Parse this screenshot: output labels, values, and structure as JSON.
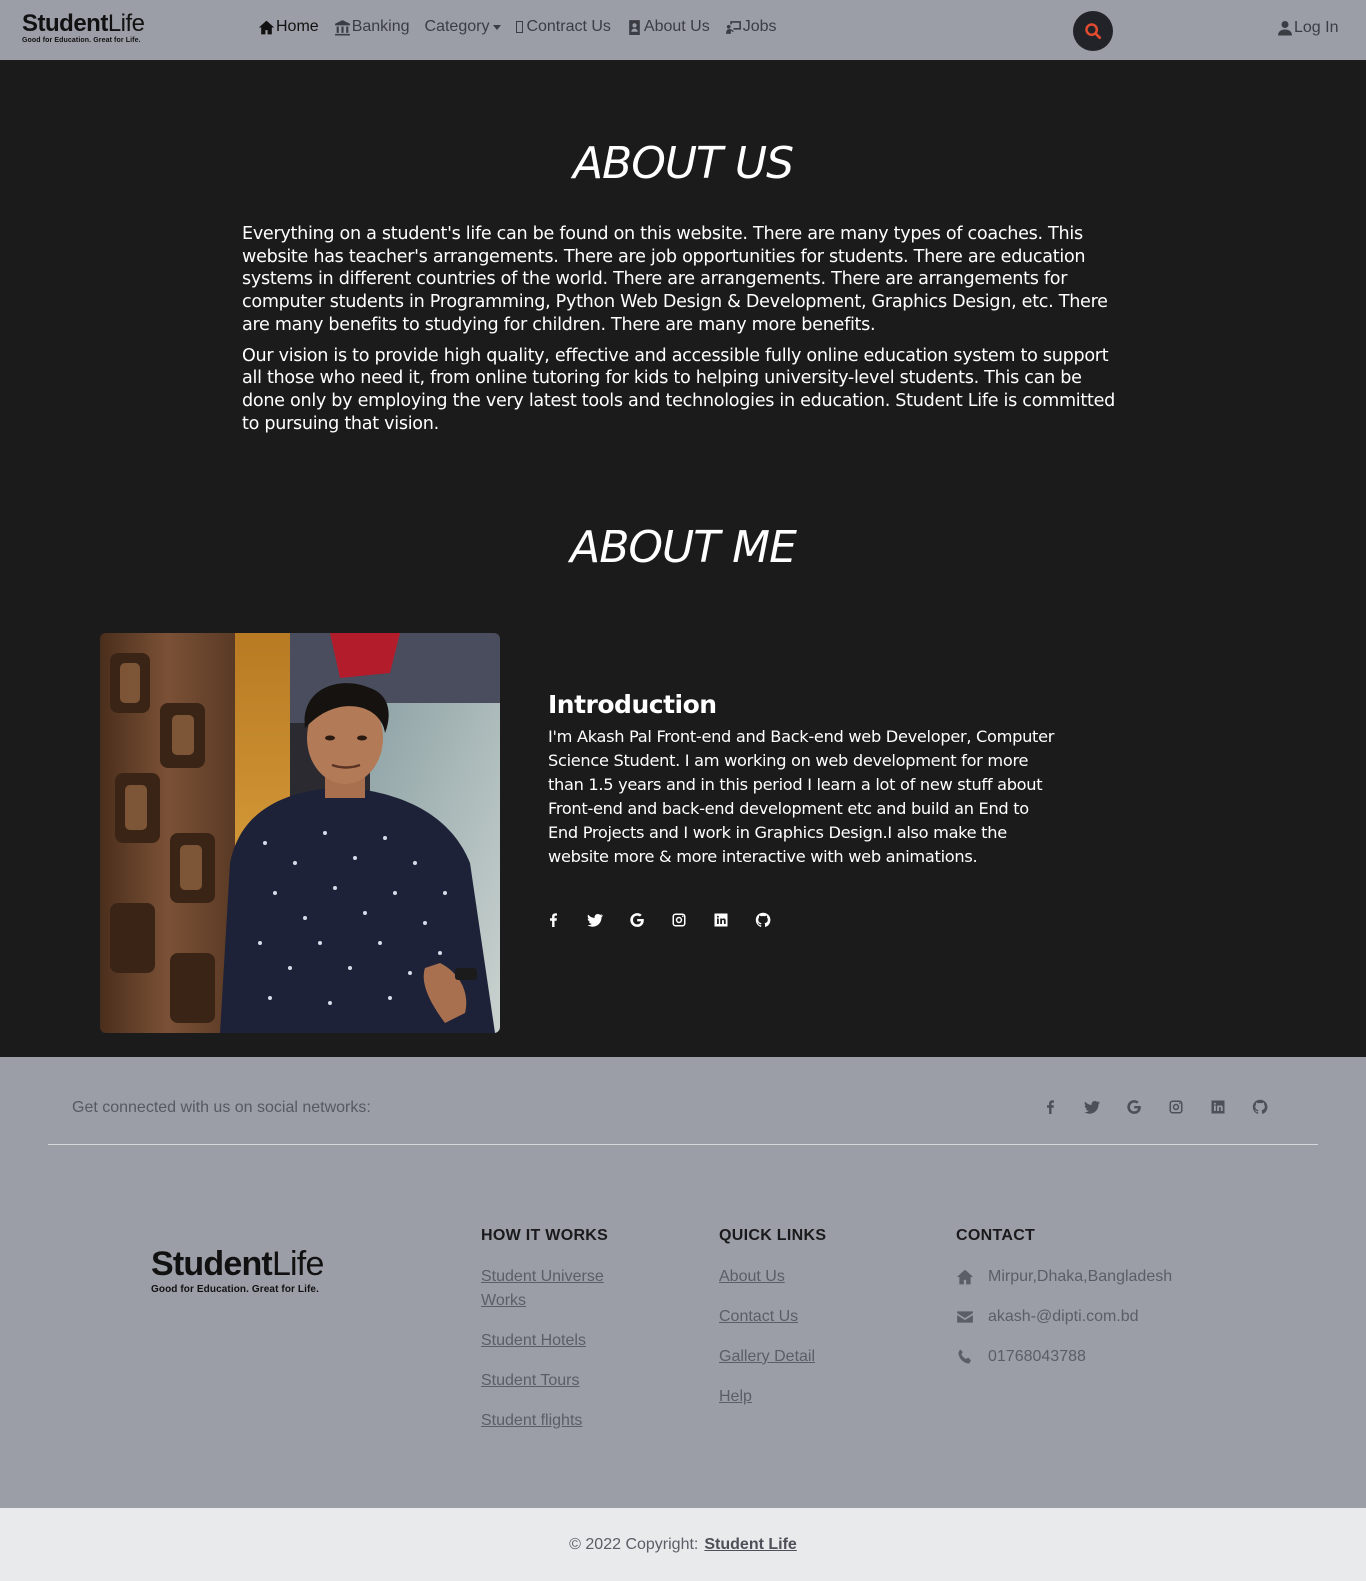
{
  "brand": {
    "name_bold": "Student",
    "name_light": "Life",
    "tagline": "Good for Education. Great for Life."
  },
  "nav": {
    "home": "Home",
    "banking": "Banking",
    "category": "Category",
    "contract": "Contract Us",
    "about": "About Us",
    "jobs": "Jobs",
    "login": "Log In"
  },
  "about_us": {
    "title": "ABOUT US",
    "p1": "Everything on a student's life can be found on this website. There are many types of coaches. This website has teacher's arrangements. There are job opportunities for students. There are education systems in different countries of the world. There are arrangements. There are arrangements for computer students in Programming, Python Web Design & Development, Graphics Design, etc. There are many benefits to studying for children. There are many more benefits.",
    "p2": "Our vision is to provide high quality, effective and accessible fully online education system to support all those who need it, from online tutoring for kids to helping university-level students. This can be done only by employing the very latest tools and technologies in education. Student Life is committed to pursuing that vision."
  },
  "about_me": {
    "title": "ABOUT ME",
    "intro_title": "Introduction",
    "intro_text": "I'm Akash Pal Front-end and Back-end web Developer, Computer Science Student. I am working on web development for more than 1.5 years and in this period I learn a lot of new stuff about Front-end and back-end development etc and build an End to End Projects and I work in Graphics Design.I also make the website more & more interactive with web animations.",
    "social_icons": [
      "facebook-icon",
      "twitter-icon",
      "google-icon",
      "instagram-icon",
      "linkedin-icon",
      "github-icon"
    ]
  },
  "footer": {
    "connect_text": "Get connected with us on social networks:",
    "how_it_works": {
      "heading": "HOW IT WORKS",
      "links": [
        "Student Universe Works",
        "Student Hotels",
        "Student Tours",
        "Student flights"
      ]
    },
    "quick_links": {
      "heading": "QUICK LINKS",
      "links": [
        "About Us",
        "Contact Us",
        "Gallery Detail",
        "Help"
      ]
    },
    "contact": {
      "heading": "CONTACT",
      "address": "Mirpur,Dhaka,Bangladesh",
      "email": "akash-@dipti.com.bd",
      "phone": "01768043788"
    },
    "copyright_prefix": "© 2022 Copyright:",
    "copyright_link": "Student Life"
  },
  "colors": {
    "nav_bg": "#9c9ea7",
    "body_bg": "#1b1b1c",
    "search_accent": "#e04a2e",
    "bottom_bar": "#e9eaec"
  }
}
